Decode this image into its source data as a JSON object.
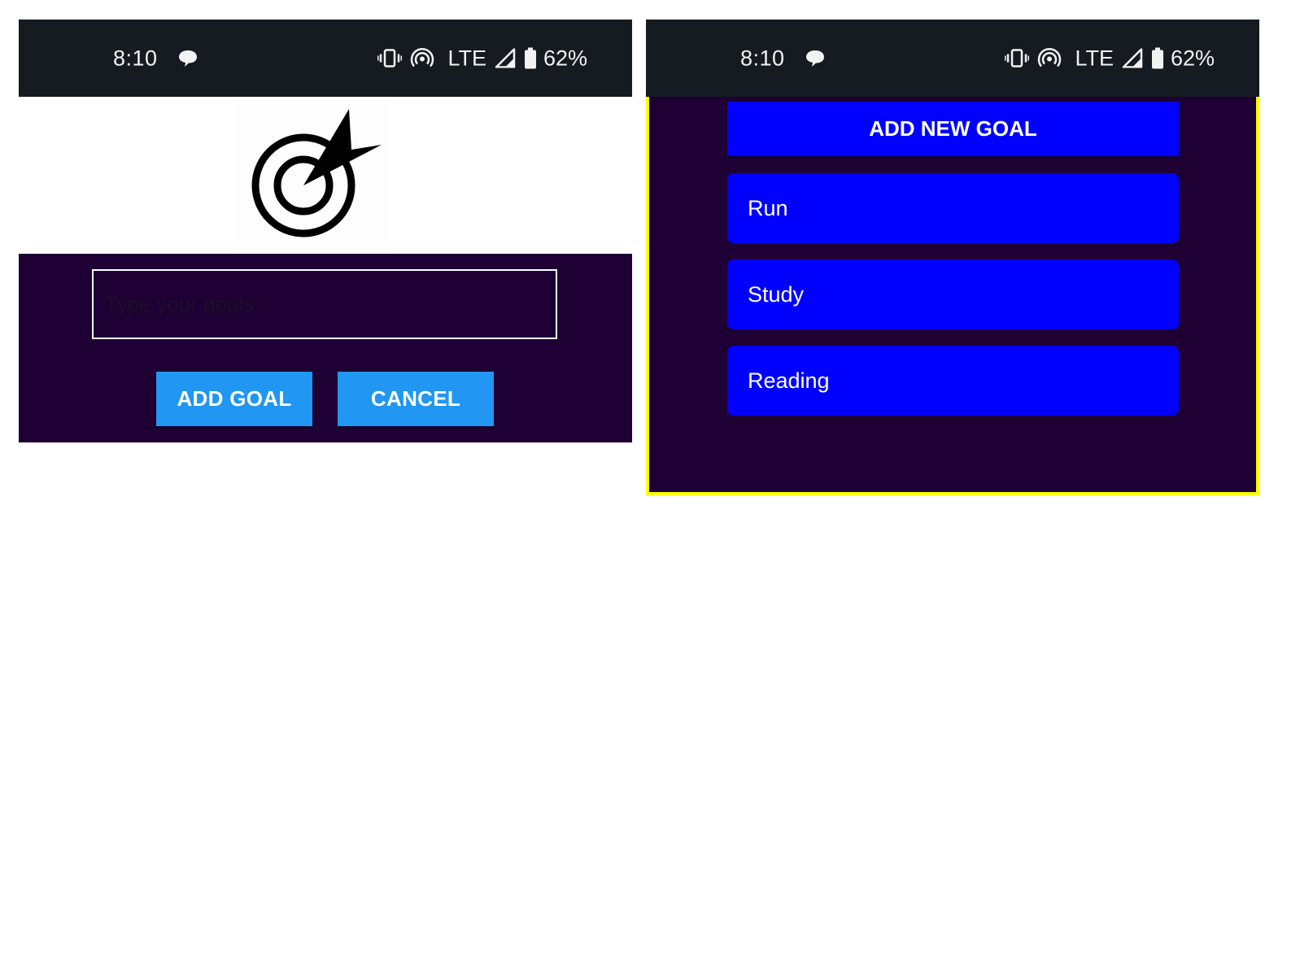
{
  "status_bar": {
    "time": "8:10",
    "network": "LTE",
    "battery": "62%",
    "icons": [
      "message-icon",
      "vibrate-icon",
      "hotspot-icon",
      "signal-icon",
      "battery-icon"
    ]
  },
  "add_screen": {
    "input_placeholder": "Type your goals",
    "add_button": "ADD GOAL",
    "cancel_button": "CANCEL"
  },
  "list_screen": {
    "add_new_button": "ADD NEW GOAL",
    "goals": [
      "Run",
      "Study",
      "Reading"
    ]
  },
  "colors": {
    "status_bar": "#161a21",
    "panel_background": "#1e0035",
    "button_blue": "#2196f3",
    "goal_blue": "#0000ff",
    "highlight_border": "#ffff00"
  }
}
